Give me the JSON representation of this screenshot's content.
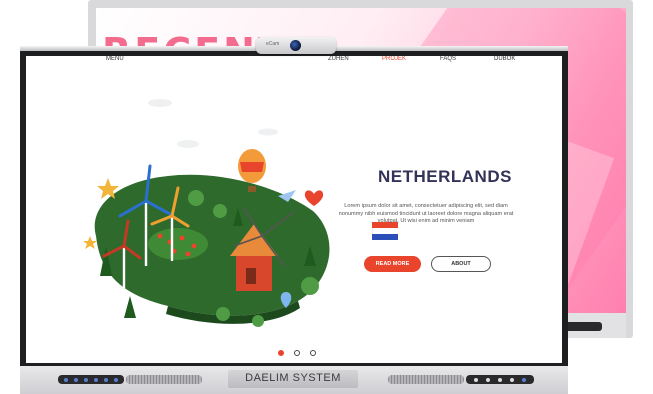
{
  "back_display": {
    "title": "RECENT"
  },
  "front_display": {
    "camera_logo": "eCam",
    "brand": "DAELIM SYSTEM"
  },
  "website": {
    "nav": [
      "MENU",
      "ZUHEN",
      "PROJEK",
      "FAQS",
      "DUBOK"
    ],
    "country": "NETHERLANDS",
    "description": "Lorem ipsum dolor sit amet, consectetuer adipiscing elit, sed diam nonummy nibh euismod tincidunt ut laoreet dolore magna aliquam erat volutpat. Ut wisi enim ad minim veniam",
    "read_more": "READ MORE",
    "about": "ABOUT",
    "flag_colors": [
      "#e8452c",
      "#ffffff",
      "#2b4fb8"
    ],
    "accent_color": "#e8452c",
    "slides": 3,
    "active_slide": 1
  }
}
